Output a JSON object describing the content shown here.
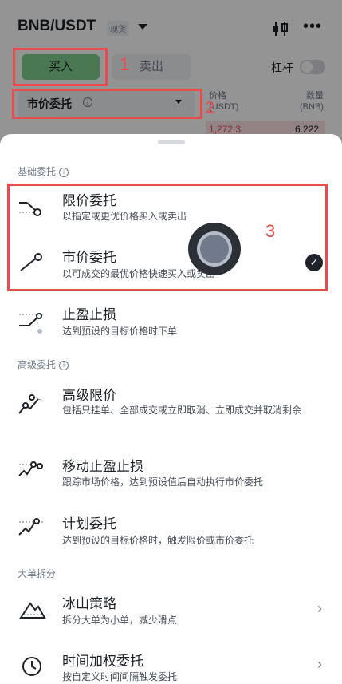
{
  "header": {
    "pair": "BNB/USDT",
    "market_badge": "现货",
    "buy_label": "买入",
    "sell_label": "卖出",
    "leverage_label": "杠杆"
  },
  "order_type": {
    "current": "市价委托"
  },
  "orderbook": {
    "price_header": "价格",
    "price_unit": "(USDT)",
    "qty_header": "数量",
    "qty_unit": "(BNB)",
    "ask_price": "1,272.3",
    "ask_qty": "6.222"
  },
  "annotations": [
    "1",
    "2",
    "3"
  ],
  "sheet": {
    "basic_section": "基础委托",
    "advanced_section": "高级委托",
    "split_section": "大单拆分",
    "items": [
      {
        "title": "限价委托",
        "desc": "以指定或更优价格买入或卖出",
        "icon": "limit-order-icon"
      },
      {
        "title": "市价委托",
        "desc": "以可成交的最优价格快速买入或卖出",
        "icon": "market-order-icon",
        "selected": true
      },
      {
        "title": "止盈止损",
        "desc": "达到预设的目标价格时下单",
        "icon": "stop-limit-icon"
      },
      {
        "title": "高级限价",
        "desc": "包括只挂单、全部成交或立即取消、立即成交并取消剩余",
        "icon": "advanced-limit-icon"
      },
      {
        "title": "移动止盈止损",
        "desc": "跟踪市场价格，达到预设值后自动执行市价委托",
        "icon": "trailing-stop-icon"
      },
      {
        "title": "计划委托",
        "desc": "达到预设的目标价格时，触发限价或市价委托",
        "icon": "trigger-order-icon"
      },
      {
        "title": "冰山策略",
        "desc": "拆分大单为小单，减少滑点",
        "icon": "iceberg-icon"
      },
      {
        "title": "时间加权委托",
        "desc": "按自定义时间间隔触发委托",
        "icon": "clock-icon"
      }
    ]
  }
}
